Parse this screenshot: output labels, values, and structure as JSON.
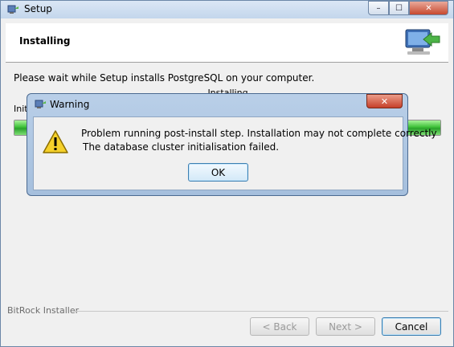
{
  "window": {
    "title": "Setup",
    "icon": "bitrock-setup-icon",
    "controls": {
      "minimize": "–",
      "maximize": "☐",
      "close": "✕"
    }
  },
  "header": {
    "title": "Installing",
    "image": "install-computer-arrow-icon"
  },
  "main": {
    "message": "Please wait while Setup installs PostgreSQL on your computer.",
    "status": "Installing",
    "detail": "Initi",
    "progress": 1.0
  },
  "footer": {
    "brand": "BitRock Installer",
    "back_label": "< Back",
    "next_label": "Next >",
    "cancel_label": "Cancel"
  },
  "dialog": {
    "title": "Warning",
    "close_label": "✕",
    "icon": "warning-icon",
    "message_line1": "Problem running post-install step. Installation may not complete correctly",
    "message_line2": "The database cluster initialisation failed.",
    "ok_label": "OK"
  },
  "colors": {
    "progress_fill": "#3fc13a",
    "warning_yellow": "#f5d02a",
    "accent": "#3c7fb1"
  }
}
